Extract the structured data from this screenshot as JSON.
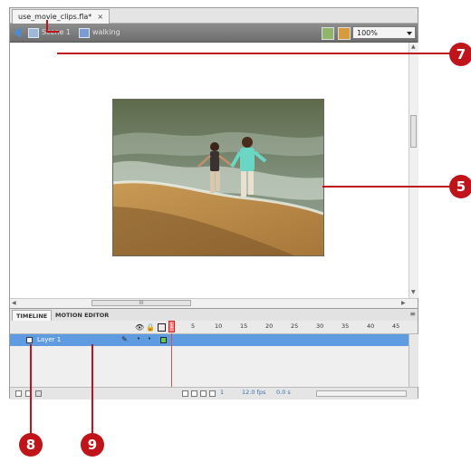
{
  "document": {
    "tab_label": "use_movie_clips.fla*",
    "close_glyph": "×"
  },
  "edit_bar": {
    "scene_label": "Scene 1",
    "symbol_label": "walking",
    "zoom_value": "100%"
  },
  "stage": {
    "scroll_marker": "III",
    "image_alt": "Couple walking on beach"
  },
  "panel": {
    "tabs": [
      {
        "label": "TIMELINE"
      },
      {
        "label": "MOTION EDITOR"
      }
    ],
    "menu_glyph": "≡"
  },
  "timeline": {
    "header_icons": [
      "eye-icon",
      "lock-icon",
      "outline-icon"
    ],
    "current_frame": "1",
    "frame_numbers": [
      "5",
      "10",
      "15",
      "20",
      "25",
      "30",
      "35",
      "40",
      "45"
    ],
    "layer": {
      "name": "Layer 1"
    },
    "footer": {
      "current_frame": "1",
      "fps": "12.0 fps",
      "elapsed": "0.0 s"
    }
  },
  "callouts": [
    "7",
    "5",
    "8",
    "9"
  ]
}
